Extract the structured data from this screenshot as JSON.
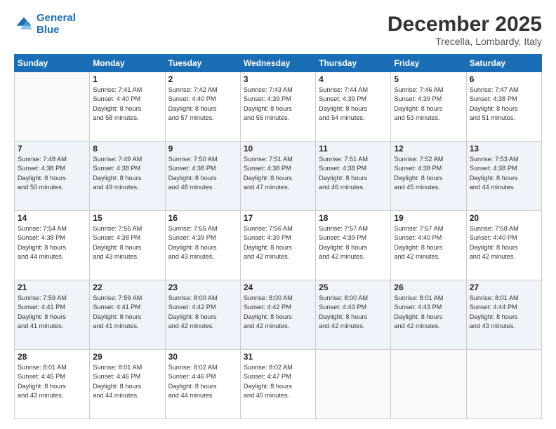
{
  "header": {
    "logo_general": "General",
    "logo_blue": "Blue",
    "title": "December 2025",
    "subtitle": "Trecella, Lombardy, Italy"
  },
  "weekdays": [
    "Sunday",
    "Monday",
    "Tuesday",
    "Wednesday",
    "Thursday",
    "Friday",
    "Saturday"
  ],
  "weeks": [
    [
      {
        "day": "",
        "sunrise": "",
        "sunset": "",
        "daylight": ""
      },
      {
        "day": "1",
        "sunrise": "Sunrise: 7:41 AM",
        "sunset": "Sunset: 4:40 PM",
        "daylight": "Daylight: 8 hours and 58 minutes."
      },
      {
        "day": "2",
        "sunrise": "Sunrise: 7:42 AM",
        "sunset": "Sunset: 4:40 PM",
        "daylight": "Daylight: 8 hours and 57 minutes."
      },
      {
        "day": "3",
        "sunrise": "Sunrise: 7:43 AM",
        "sunset": "Sunset: 4:39 PM",
        "daylight": "Daylight: 8 hours and 55 minutes."
      },
      {
        "day": "4",
        "sunrise": "Sunrise: 7:44 AM",
        "sunset": "Sunset: 4:39 PM",
        "daylight": "Daylight: 8 hours and 54 minutes."
      },
      {
        "day": "5",
        "sunrise": "Sunrise: 7:46 AM",
        "sunset": "Sunset: 4:39 PM",
        "daylight": "Daylight: 8 hours and 53 minutes."
      },
      {
        "day": "6",
        "sunrise": "Sunrise: 7:47 AM",
        "sunset": "Sunset: 4:38 PM",
        "daylight": "Daylight: 8 hours and 51 minutes."
      }
    ],
    [
      {
        "day": "7",
        "sunrise": "Sunrise: 7:48 AM",
        "sunset": "Sunset: 4:38 PM",
        "daylight": "Daylight: 8 hours and 50 minutes."
      },
      {
        "day": "8",
        "sunrise": "Sunrise: 7:49 AM",
        "sunset": "Sunset: 4:38 PM",
        "daylight": "Daylight: 8 hours and 49 minutes."
      },
      {
        "day": "9",
        "sunrise": "Sunrise: 7:50 AM",
        "sunset": "Sunset: 4:38 PM",
        "daylight": "Daylight: 8 hours and 48 minutes."
      },
      {
        "day": "10",
        "sunrise": "Sunrise: 7:51 AM",
        "sunset": "Sunset: 4:38 PM",
        "daylight": "Daylight: 8 hours and 47 minutes."
      },
      {
        "day": "11",
        "sunrise": "Sunrise: 7:51 AM",
        "sunset": "Sunset: 4:38 PM",
        "daylight": "Daylight: 8 hours and 46 minutes."
      },
      {
        "day": "12",
        "sunrise": "Sunrise: 7:52 AM",
        "sunset": "Sunset: 4:38 PM",
        "daylight": "Daylight: 8 hours and 45 minutes."
      },
      {
        "day": "13",
        "sunrise": "Sunrise: 7:53 AM",
        "sunset": "Sunset: 4:38 PM",
        "daylight": "Daylight: 8 hours and 44 minutes."
      }
    ],
    [
      {
        "day": "14",
        "sunrise": "Sunrise: 7:54 AM",
        "sunset": "Sunset: 4:38 PM",
        "daylight": "Daylight: 8 hours and 44 minutes."
      },
      {
        "day": "15",
        "sunrise": "Sunrise: 7:55 AM",
        "sunset": "Sunset: 4:38 PM",
        "daylight": "Daylight: 8 hours and 43 minutes."
      },
      {
        "day": "16",
        "sunrise": "Sunrise: 7:55 AM",
        "sunset": "Sunset: 4:39 PM",
        "daylight": "Daylight: 8 hours and 43 minutes."
      },
      {
        "day": "17",
        "sunrise": "Sunrise: 7:56 AM",
        "sunset": "Sunset: 4:39 PM",
        "daylight": "Daylight: 8 hours and 42 minutes."
      },
      {
        "day": "18",
        "sunrise": "Sunrise: 7:57 AM",
        "sunset": "Sunset: 4:39 PM",
        "daylight": "Daylight: 8 hours and 42 minutes."
      },
      {
        "day": "19",
        "sunrise": "Sunrise: 7:57 AM",
        "sunset": "Sunset: 4:40 PM",
        "daylight": "Daylight: 8 hours and 42 minutes."
      },
      {
        "day": "20",
        "sunrise": "Sunrise: 7:58 AM",
        "sunset": "Sunset: 4:40 PM",
        "daylight": "Daylight: 8 hours and 42 minutes."
      }
    ],
    [
      {
        "day": "21",
        "sunrise": "Sunrise: 7:59 AM",
        "sunset": "Sunset: 4:41 PM",
        "daylight": "Daylight: 8 hours and 41 minutes."
      },
      {
        "day": "22",
        "sunrise": "Sunrise: 7:59 AM",
        "sunset": "Sunset: 4:41 PM",
        "daylight": "Daylight: 8 hours and 41 minutes."
      },
      {
        "day": "23",
        "sunrise": "Sunrise: 8:00 AM",
        "sunset": "Sunset: 4:42 PM",
        "daylight": "Daylight: 8 hours and 42 minutes."
      },
      {
        "day": "24",
        "sunrise": "Sunrise: 8:00 AM",
        "sunset": "Sunset: 4:42 PM",
        "daylight": "Daylight: 8 hours and 42 minutes."
      },
      {
        "day": "25",
        "sunrise": "Sunrise: 8:00 AM",
        "sunset": "Sunset: 4:43 PM",
        "daylight": "Daylight: 8 hours and 42 minutes."
      },
      {
        "day": "26",
        "sunrise": "Sunrise: 8:01 AM",
        "sunset": "Sunset: 4:43 PM",
        "daylight": "Daylight: 8 hours and 42 minutes."
      },
      {
        "day": "27",
        "sunrise": "Sunrise: 8:01 AM",
        "sunset": "Sunset: 4:44 PM",
        "daylight": "Daylight: 8 hours and 43 minutes."
      }
    ],
    [
      {
        "day": "28",
        "sunrise": "Sunrise: 8:01 AM",
        "sunset": "Sunset: 4:45 PM",
        "daylight": "Daylight: 8 hours and 43 minutes."
      },
      {
        "day": "29",
        "sunrise": "Sunrise: 8:01 AM",
        "sunset": "Sunset: 4:46 PM",
        "daylight": "Daylight: 8 hours and 44 minutes."
      },
      {
        "day": "30",
        "sunrise": "Sunrise: 8:02 AM",
        "sunset": "Sunset: 4:46 PM",
        "daylight": "Daylight: 8 hours and 44 minutes."
      },
      {
        "day": "31",
        "sunrise": "Sunrise: 8:02 AM",
        "sunset": "Sunset: 4:47 PM",
        "daylight": "Daylight: 8 hours and 45 minutes."
      },
      {
        "day": "",
        "sunrise": "",
        "sunset": "",
        "daylight": ""
      },
      {
        "day": "",
        "sunrise": "",
        "sunset": "",
        "daylight": ""
      },
      {
        "day": "",
        "sunrise": "",
        "sunset": "",
        "daylight": ""
      }
    ]
  ]
}
